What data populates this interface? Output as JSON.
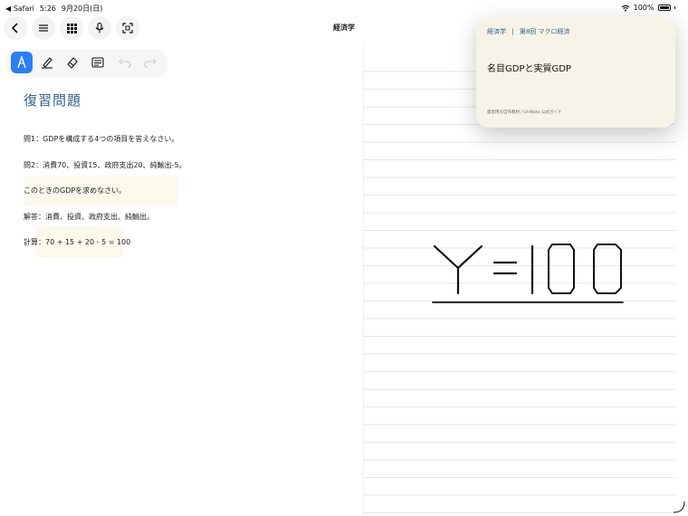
{
  "status_bar": {
    "back_app": "◀ Safari",
    "time": "5:26",
    "date": "9月20日(日)",
    "battery": "100%"
  },
  "nav": {
    "title": "経済学",
    "buttons": [
      "back-icon",
      "menu-icon",
      "grid-icon",
      "microphone-icon",
      "scan-icon"
    ]
  },
  "tools": [
    "pen-icon",
    "highlighter-icon",
    "eraser-icon",
    "text-box-icon",
    "undo-icon",
    "redo-icon"
  ],
  "page": {
    "heading": "復習問題",
    "lines": [
      "問1：GDPを構成する4つの項目を答えなさい。",
      "問2：消費70、投資15、政府支出20、純輸出-5。",
      "このときのGDPを求めなさい。",
      "解答：消費、投資、政府支出、純輸出。",
      "計算：70 + 15 + 20 - 5 = 100"
    ]
  },
  "handwriting": {
    "text": "Y=100"
  },
  "card": {
    "subject": "経済学",
    "separator": "|",
    "lesson": "第8回 マクロ経済",
    "title": "名目GDPと実質GDP",
    "footer": "復習用の自作教材 / UniNote 公式ガイド"
  },
  "colors": {
    "accent": "#2c7ff2",
    "heading": "#2f5f88",
    "card_bg": "#f8f3e8",
    "highlight": "#fbf9ec"
  }
}
